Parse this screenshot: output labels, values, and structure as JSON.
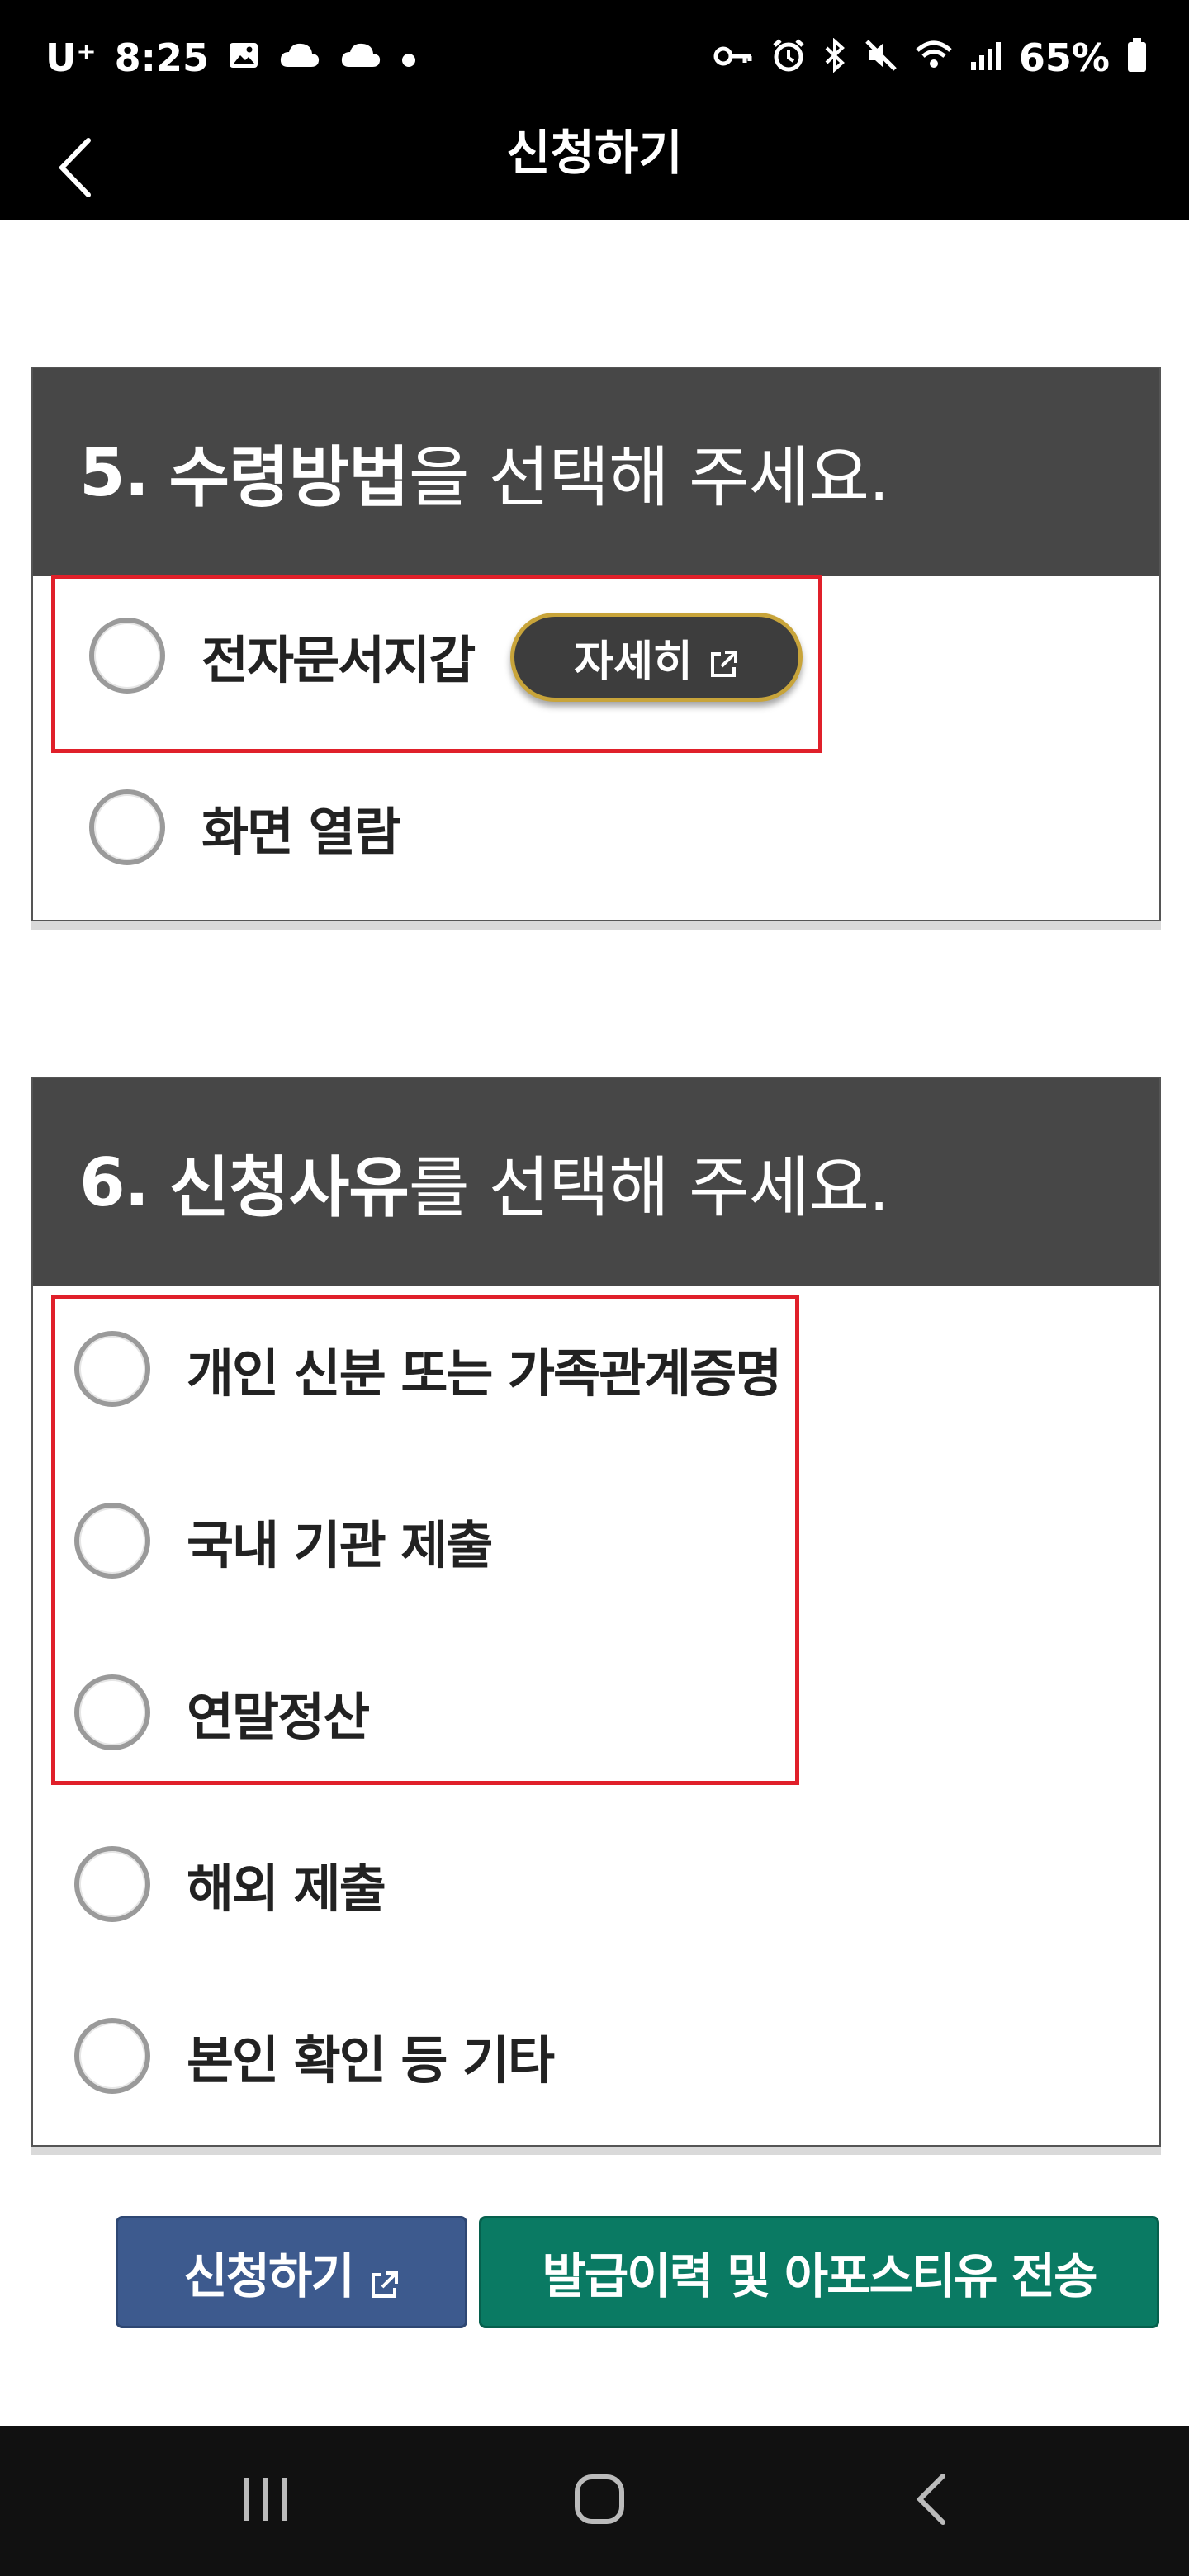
{
  "status_bar": {
    "carrier": "U⁺",
    "time": "8:25",
    "battery": "65%",
    "left_icons": [
      "gallery-icon",
      "cloud-icon",
      "cloud-icon",
      "dot-icon"
    ],
    "right_icons": [
      "key-icon",
      "alarm-icon",
      "bluetooth-icon",
      "mute-icon",
      "wifi-icon",
      "signal-icon",
      "battery-icon"
    ]
  },
  "header": {
    "title": "신청하기",
    "back_icon": "chevron-left-icon"
  },
  "section5": {
    "number": "5.",
    "strong": "수령방법",
    "rest": "을 선택해 주세요.",
    "options": [
      {
        "label": "전자문서지갑",
        "selected": false
      },
      {
        "label": "화면 열람",
        "selected": false
      }
    ],
    "detail_button": "자세히"
  },
  "section6": {
    "number": "6.",
    "strong": "신청사유",
    "rest": "를 선택해 주세요.",
    "options": [
      {
        "label": "개인 신분 또는 가족관계증명",
        "selected": false
      },
      {
        "label": "국내 기관 제출",
        "selected": false
      },
      {
        "label": "연말정산",
        "selected": false
      },
      {
        "label": "해외 제출",
        "selected": false
      },
      {
        "label": "본인 확인 등 기타",
        "selected": false
      }
    ]
  },
  "actions": {
    "apply": "신청하기",
    "history": "발급이력 및 아포스티유 전송"
  },
  "colors": {
    "section_header": "#474747",
    "highlight": "#e0202a",
    "apply_button": "#3d5a8e",
    "history_button": "#0a7a63",
    "detail_border": "#c8a43a"
  },
  "nav": [
    "recents-icon",
    "home-icon",
    "back-icon"
  ]
}
